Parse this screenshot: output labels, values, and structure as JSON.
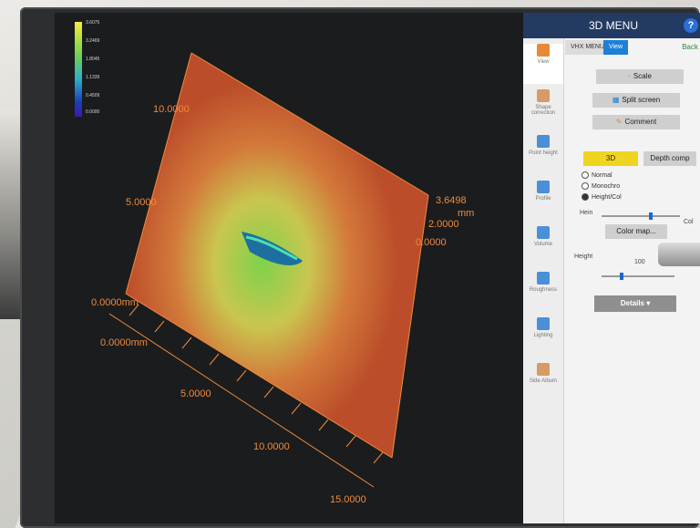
{
  "scale_bar": {
    "ticks": [
      "3.6075",
      "3.2469",
      "1.8045",
      "1.1339",
      "0.4509",
      "0.0000"
    ]
  },
  "axes": {
    "x_labels": [
      "0.0000mm",
      "5.0000",
      "10.0000",
      "15.0000"
    ],
    "y_labels": [
      "0.0000mm",
      "5.0000",
      "10.0000"
    ],
    "z_labels": [
      "0.0000",
      "2.0000",
      "3.6498",
      "mm"
    ]
  },
  "menu": {
    "title": "3D MENU",
    "help": "?",
    "breadcrumb": [
      "VHX MENU",
      "View"
    ],
    "back": "Back",
    "sidebar": [
      "View",
      "Shape correction",
      "Point height",
      "Profile",
      "Volume",
      "Roughness",
      "Lighting",
      "Side Album"
    ],
    "buttons": {
      "scale": "Scale",
      "split": "Split screen",
      "comment": "Comment"
    },
    "mode": {
      "three_d": "3D",
      "depth": "Depth comp"
    },
    "color_modes": [
      "Normal",
      "Monochro",
      "Height/Col"
    ],
    "height_col": {
      "left": "Hein",
      "right": "Col"
    },
    "color_map": "Color map...",
    "height": {
      "label": "Height",
      "value": "100"
    },
    "details": "Details"
  },
  "colors": {
    "accent": "#1e7fd6",
    "surface": "#c2542a",
    "header": "#233a62",
    "highlight": "#efd520"
  }
}
